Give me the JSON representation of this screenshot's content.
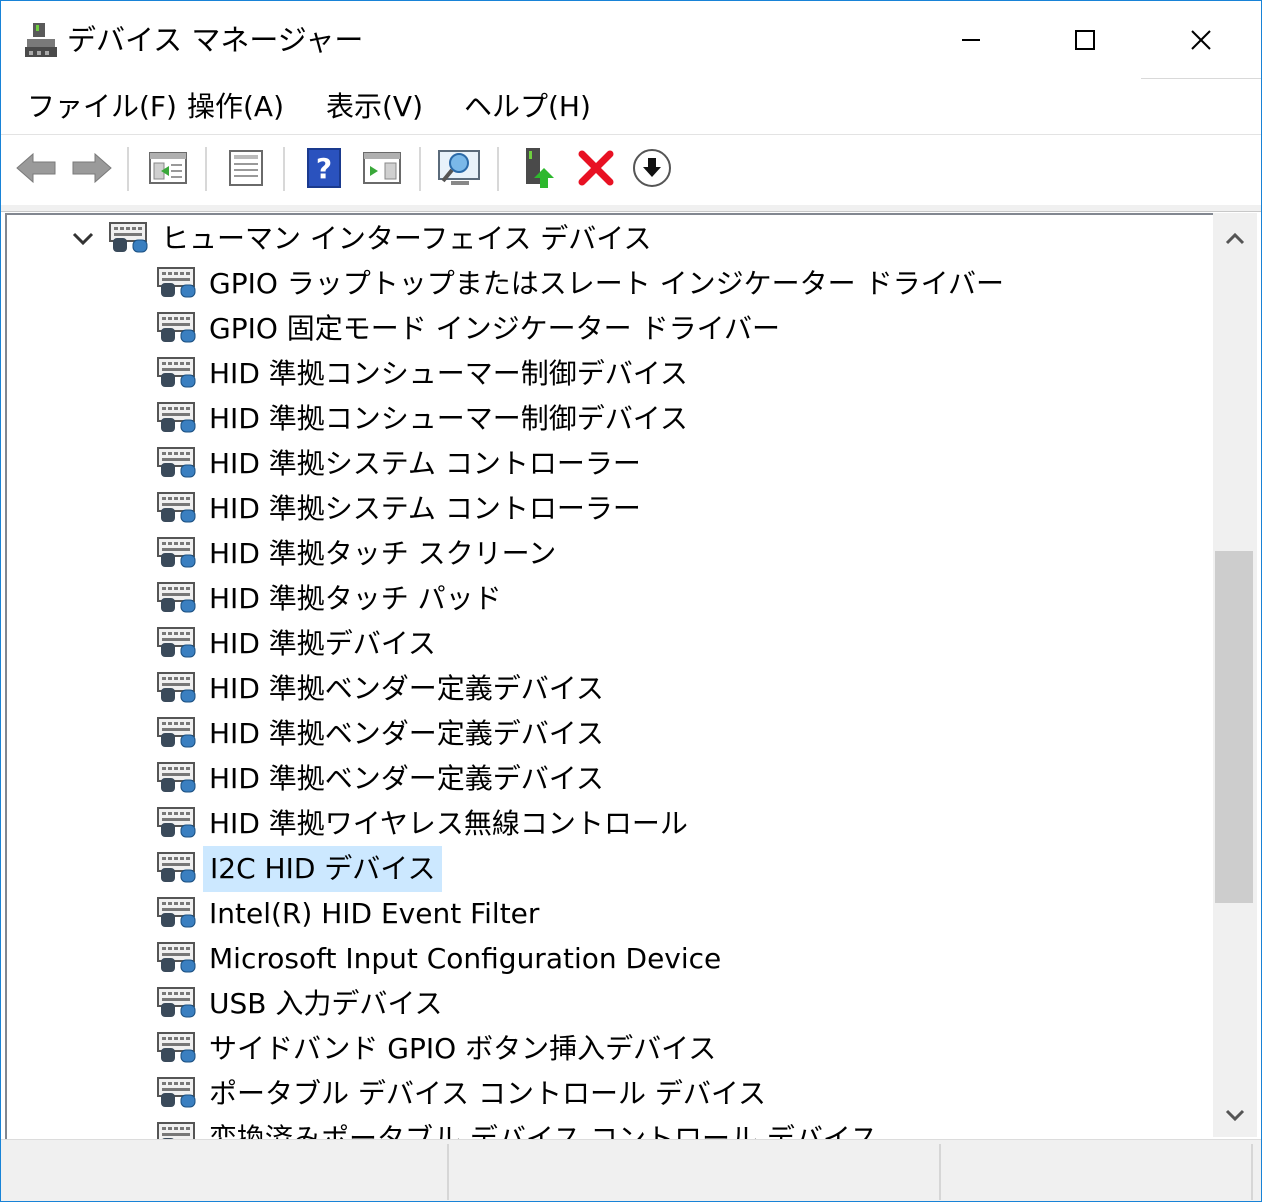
{
  "window": {
    "title": "デバイス マネージャー"
  },
  "menu": {
    "file": "ファイル(F)",
    "action": "操作(A)",
    "view": "表示(V)",
    "help": "ヘルプ(H)"
  },
  "tree": {
    "category": "ヒューマン インターフェイス デバイス",
    "devices": [
      "GPIO ラップトップまたはスレート インジケーター ドライバー",
      "GPIO 固定モード インジケーター ドライバー",
      "HID 準拠コンシューマー制御デバイス",
      "HID 準拠コンシューマー制御デバイス",
      "HID 準拠システム コントローラー",
      "HID 準拠システム コントローラー",
      "HID 準拠タッチ スクリーン",
      "HID 準拠タッチ パッド",
      "HID 準拠デバイス",
      "HID 準拠ベンダー定義デバイス",
      "HID 準拠ベンダー定義デバイス",
      "HID 準拠ベンダー定義デバイス",
      "HID 準拠ワイヤレス無線コントロール",
      "I2C HID デバイス",
      "Intel(R) HID Event Filter",
      "Microsoft Input Configuration Device",
      "USB 入力デバイス",
      "サイドバンド GPIO ボタン挿入デバイス",
      "ポータブル デバイス コントロール デバイス",
      "変換済みポータブル デバイス コントロール デバイス"
    ],
    "selected_device": "I2C HID デバイス"
  },
  "colors": {
    "window_border": "#1883d7",
    "selection": "#cce8ff",
    "red_x": "#e81123",
    "help_blue": "#2a52be"
  },
  "icons": {
    "app": "device-manager-icon",
    "device": "hid-keyboard-mouse-icon"
  }
}
